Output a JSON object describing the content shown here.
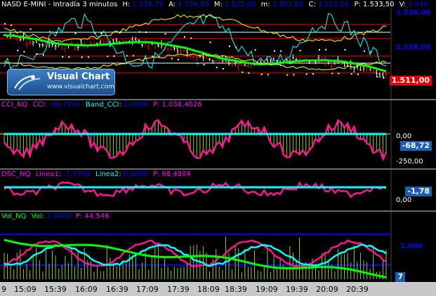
{
  "price_panel": {
    "symbol": "NASD E-MINI - Intradía 3 minutos",
    "labels": [
      {
        "name": "H:",
        "value": "1.539,75"
      },
      {
        "name": "A:",
        "value": "1.524,50"
      },
      {
        "name": "M:",
        "value": "1.525,00"
      },
      {
        "name": "m:",
        "value": "1.501,00"
      },
      {
        "name": "C:",
        "value": "1.522,00"
      },
      {
        "name": "P:",
        "value": "1.533,50"
      },
      {
        "name": "V:",
        "value": "1.440"
      }
    ],
    "axis_labels": [
      "1.536,00",
      "1.528,00"
    ],
    "current_price": "1.511,00",
    "colors": {
      "up": "#ffffff",
      "down": "#ff0000",
      "ma_green": "#00ff00",
      "cyan": "#00ffff",
      "yellow": "#ffff00",
      "blue": "#0000ff"
    }
  },
  "logo": {
    "title": "Visual Chart",
    "url": "www.visualchart.com"
  },
  "cci_panel": {
    "name": "CCI_NQ",
    "labels": [
      {
        "name": "CCI:",
        "value": "-68,7241"
      },
      {
        "name": "Band_CCI:",
        "value": "0,0000"
      },
      {
        "name": "P:",
        "value": "1.038,4026"
      }
    ],
    "axis_labels": [
      "0,00",
      "-250,00"
    ],
    "current_value": "-68,72"
  },
  "dsc_panel": {
    "name": "DSC_NQ",
    "labels": [
      {
        "name": "Linea1:",
        "value": "-1,7768"
      },
      {
        "name": "Linea2:",
        "value": "0,0000"
      },
      {
        "name": "P:",
        "value": "68,4804"
      }
    ],
    "axis_labels": [
      "0,00"
    ],
    "current_value": "-1,78"
  },
  "vol_panel": {
    "name": "Vol_NQ",
    "labels": [
      {
        "name": "Vol:",
        "value": "7,0000"
      },
      {
        "name": "P:",
        "value": "44,546"
      }
    ],
    "axis_labels": [
      "1.000"
    ],
    "current_value": "7"
  },
  "time_axis": [
    "9",
    "15:09",
    "15:39",
    "16:09",
    "16:39",
    "17:09",
    "17:39",
    "18:09",
    "18:39",
    "19:09",
    "19:39",
    "20:09",
    "20:39"
  ]
}
